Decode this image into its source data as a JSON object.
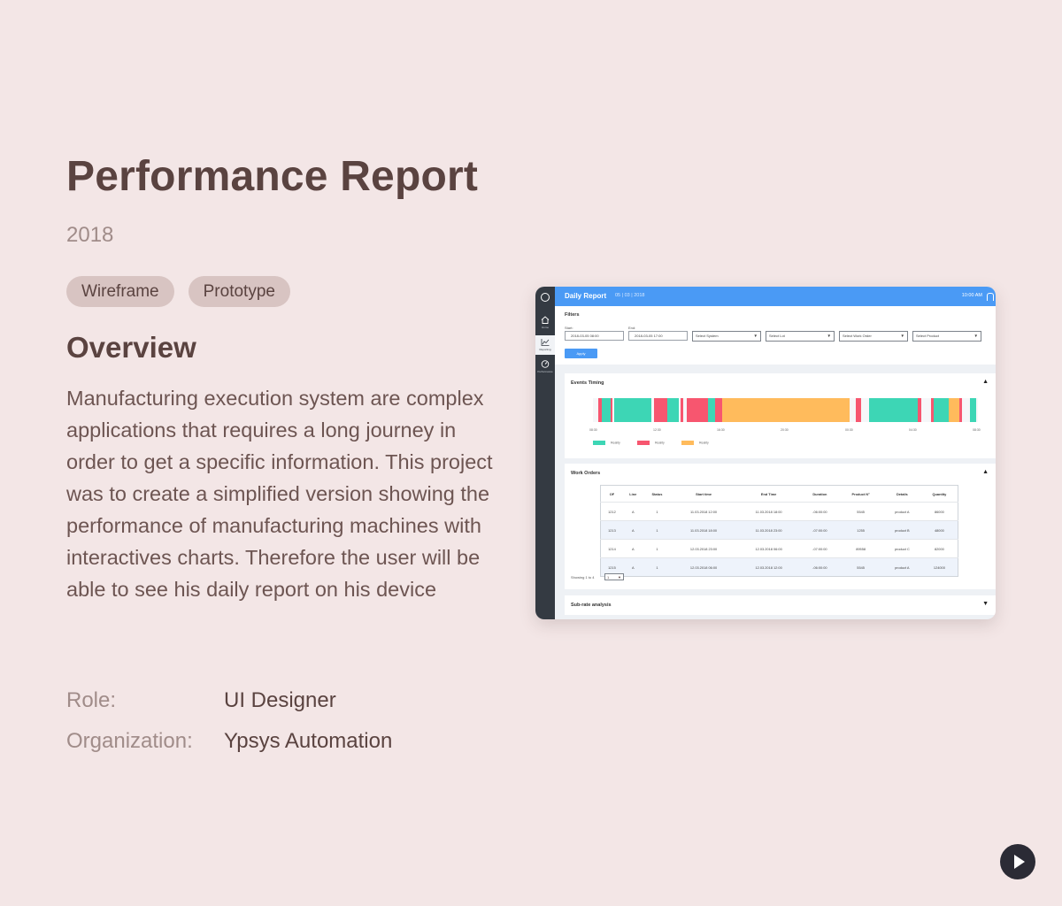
{
  "title": "Performance Report",
  "year": "2018",
  "tags": [
    "Wireframe",
    "Prototype"
  ],
  "overview_heading": "Overview",
  "description": "Manufacturing execution system are complex applications that requires a long journey in order to get a specific information. This project was to create a simplified version showing the performance of manufacturing machines with interactives charts. Therefore the user will be able to see his daily report on his device",
  "role": {
    "label": "Role:",
    "value": "UI Designer"
  },
  "organization": {
    "label": "Organization:",
    "value": "Ypsys Automation"
  },
  "colors": {
    "background": "#f3e6e6",
    "accent": "#4a9af5",
    "green": "#3dd6b5",
    "red": "#f7566f",
    "orange": "#ffbb5c"
  },
  "mockup": {
    "header": {
      "title": "Daily Report",
      "date": "05 | 03 | 2018",
      "time": "10:00 AM"
    },
    "sidebar": [
      "Home",
      "Reporting",
      "Performance"
    ],
    "filters": {
      "title": "Filters",
      "start_label": "Start:",
      "start_value": "2018-03-05     08:00",
      "end_label": "End:",
      "end_value": "2018-03-05     17:00",
      "selects": [
        "Select System",
        "Select Lot",
        "Select Work Order",
        "Select Product"
      ],
      "apply": "Apply"
    },
    "events_timing": {
      "title": "Events Timing",
      "ticks": [
        "08:30",
        "12:30",
        "16:30",
        "20:30",
        "00:30",
        "04:30",
        "08:30"
      ],
      "legend": [
        "Reality",
        "Reality",
        "Reality"
      ]
    },
    "work_orders": {
      "title": "Work Orders",
      "headers": [
        "OF",
        "Line",
        "Status",
        "Start time",
        "End Time",
        "Duration",
        "Product N°",
        "Details",
        "Quantity"
      ],
      "rows": [
        [
          "1212",
          "A",
          "1",
          "11.03.2018  12:00",
          "11.03.2018  18:00",
          "-06:00:00",
          "5545",
          "product A",
          "86000"
        ],
        [
          "1213",
          "A",
          "1",
          "11.03.2018  18:00",
          "11.03.2018  23:00",
          "-07:00:00",
          "1255",
          "product B",
          "48000"
        ],
        [
          "1214",
          "A",
          "1",
          "12.03.2018  23:00",
          "12.03.2018  06:00",
          "-07:00:00",
          "89558",
          "product C",
          "82000"
        ],
        [
          "1215",
          "A",
          "1",
          "12.03.2018  06:00",
          "12.03.2018  12:00",
          "-06:00:00",
          "5545",
          "product A",
          "124000"
        ]
      ],
      "showing": "Showing 1 to 4",
      "page": "1"
    },
    "subrate": {
      "title": "Sub-rate analysis"
    }
  }
}
